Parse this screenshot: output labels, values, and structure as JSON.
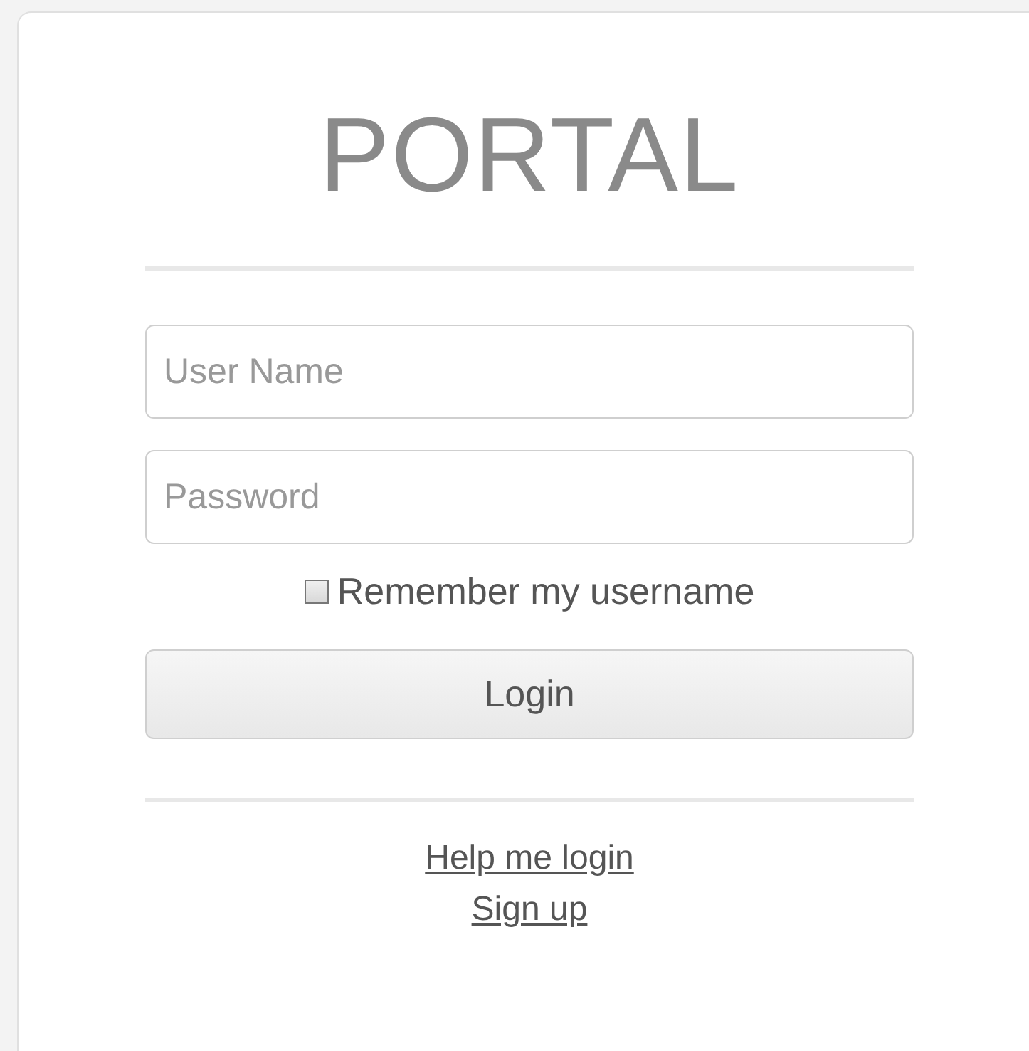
{
  "title": "PORTAL",
  "fields": [
    {
      "placeholder": "User Name"
    },
    {
      "placeholder": "Password"
    }
  ],
  "remember": {
    "label": "Remember my username",
    "checked": false
  },
  "login_button": "Login",
  "links": [
    "Help me login",
    "Sign up"
  ]
}
